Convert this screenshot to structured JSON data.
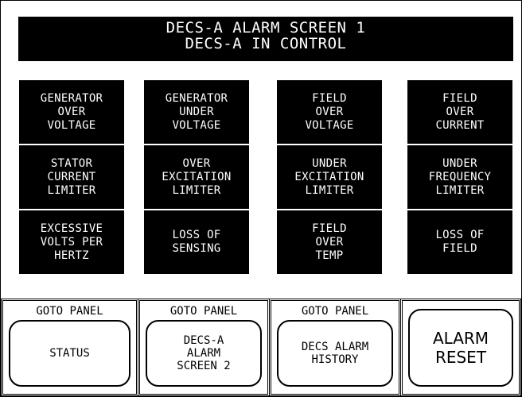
{
  "header": {
    "line1": "DECS-A ALARM SCREEN 1",
    "line2": "DECS-A IN CONTROL"
  },
  "alarms": [
    {
      "lines": [
        "GENERATOR",
        "OVER",
        "VOLTAGE"
      ]
    },
    {
      "lines": [
        "GENERATOR",
        "UNDER",
        "VOLTAGE"
      ]
    },
    {
      "lines": [
        "FIELD",
        "OVER",
        "VOLTAGE"
      ]
    },
    {
      "lines": [
        "FIELD",
        "OVER",
        "CURRENT"
      ]
    },
    {
      "lines": [
        "STATOR",
        "CURRENT",
        "LIMITER"
      ]
    },
    {
      "lines": [
        "OVER",
        "EXCITATION",
        "LIMITER"
      ]
    },
    {
      "lines": [
        "UNDER",
        "EXCITATION",
        "LIMITER"
      ]
    },
    {
      "lines": [
        "UNDER",
        "FREQUENCY",
        "LIMITER"
      ]
    },
    {
      "lines": [
        "EXCESSIVE",
        "VOLTS PER",
        "HERTZ"
      ]
    },
    {
      "lines": [
        "LOSS OF",
        "SENSING"
      ]
    },
    {
      "lines": [
        "FIELD",
        "OVER",
        "TEMP"
      ]
    },
    {
      "lines": [
        "LOSS OF",
        "FIELD"
      ]
    }
  ],
  "buttons": [
    {
      "goto": "GOTO PANEL",
      "lines": [
        "STATUS"
      ]
    },
    {
      "goto": "GOTO PANEL",
      "lines": [
        "DECS-A",
        "ALARM",
        "SCREEN 2"
      ]
    },
    {
      "goto": "GOTO PANEL",
      "lines": [
        "DECS ALARM",
        "HISTORY"
      ]
    },
    {
      "lines": [
        "ALARM",
        "RESET"
      ]
    }
  ]
}
